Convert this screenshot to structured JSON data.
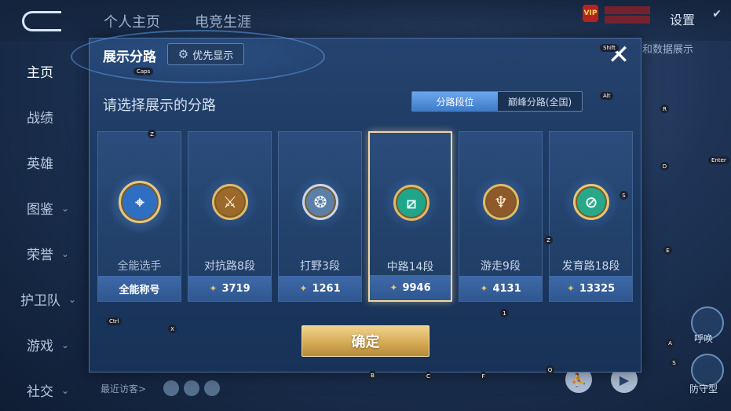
{
  "top_bar": {
    "tabs": [
      "个人主页",
      "电竞生涯"
    ],
    "settings_label": "设置",
    "vip_label": "VIP"
  },
  "side_nav": [
    {
      "label": "主页",
      "has_chevron": false
    },
    {
      "label": "战绩",
      "has_chevron": false
    },
    {
      "label": "英雄",
      "has_chevron": false
    },
    {
      "label": "图鉴",
      "has_chevron": true
    },
    {
      "label": "荣誉",
      "has_chevron": true
    },
    {
      "label": "护卫队",
      "has_chevron": true
    },
    {
      "label": "游戏",
      "has_chevron": true
    },
    {
      "label": "社交",
      "has_chevron": true
    }
  ],
  "right_partial_text": "和数据展示",
  "recent_visitors_label": "最近访客>",
  "corner_labels": {
    "a": "呼唤",
    "b": "防守型"
  },
  "dialog": {
    "title": "展示分路",
    "priority_label": "优先显示",
    "subtitle": "请选择展示的分路",
    "segments": [
      {
        "label": "分路段位",
        "active": true
      },
      {
        "label": "巅峰分路(全国)",
        "active": false
      }
    ],
    "cards": [
      {
        "label": "全能选手",
        "bottom": "全能称号",
        "points": null,
        "emblem": "allround-emblem",
        "selected": false
      },
      {
        "label": "对抗路8段",
        "bottom": "3719",
        "points": 3719,
        "emblem": "top-lane-emblem",
        "selected": false
      },
      {
        "label": "打野3段",
        "bottom": "1261",
        "points": 1261,
        "emblem": "jungle-emblem",
        "selected": false
      },
      {
        "label": "中路14段",
        "bottom": "9946",
        "points": 9946,
        "emblem": "mid-lane-emblem",
        "selected": true
      },
      {
        "label": "游走9段",
        "bottom": "4131",
        "points": 4131,
        "emblem": "roam-emblem",
        "selected": false
      },
      {
        "label": "发育路18段",
        "bottom": "13325",
        "points": 13325,
        "emblem": "farm-lane-emblem",
        "selected": false
      }
    ],
    "confirm_label": "确定"
  },
  "keyboard_overlay": [
    "Caps",
    "Shift",
    "Z",
    "Alt",
    "R",
    "D",
    "Enter",
    "S",
    "Z",
    "E",
    "1",
    "Ctrl",
    "X",
    "A",
    "S",
    "B",
    "C",
    "F",
    "Q"
  ],
  "colors": {
    "accent_gold": "#e2b868",
    "selected_border": "#f1d7a2",
    "segment_active": "#4f8ed8"
  }
}
